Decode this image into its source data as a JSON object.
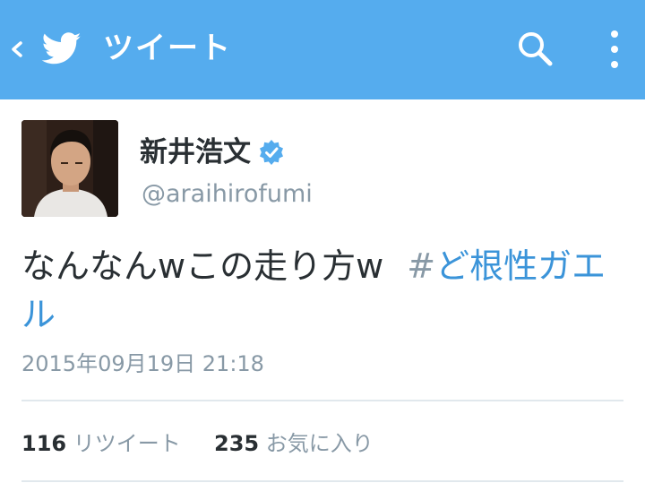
{
  "header": {
    "title": "ツイート",
    "back_icon": "chevron-left-icon",
    "logo_icon": "twitter-bird-icon",
    "search_icon": "search-icon",
    "menu_icon": "more-vertical-icon",
    "color": "#55acee"
  },
  "tweet": {
    "author_name": "新井浩文",
    "author_handle": "@araihirofumi",
    "verified": true,
    "text_main": "なんなんwこの走り方w",
    "hashtag_symbol": "#",
    "hashtag_text": "ど根性ガエル",
    "timestamp": "2015年09月19日 21:18"
  },
  "stats": {
    "retweets_count": "116",
    "retweets_label": "リツイート",
    "favorites_count": "235",
    "favorites_label": "お気に入り"
  },
  "colors": {
    "link": "#3b94d9",
    "muted": "#8899a6",
    "text": "#292f33"
  }
}
